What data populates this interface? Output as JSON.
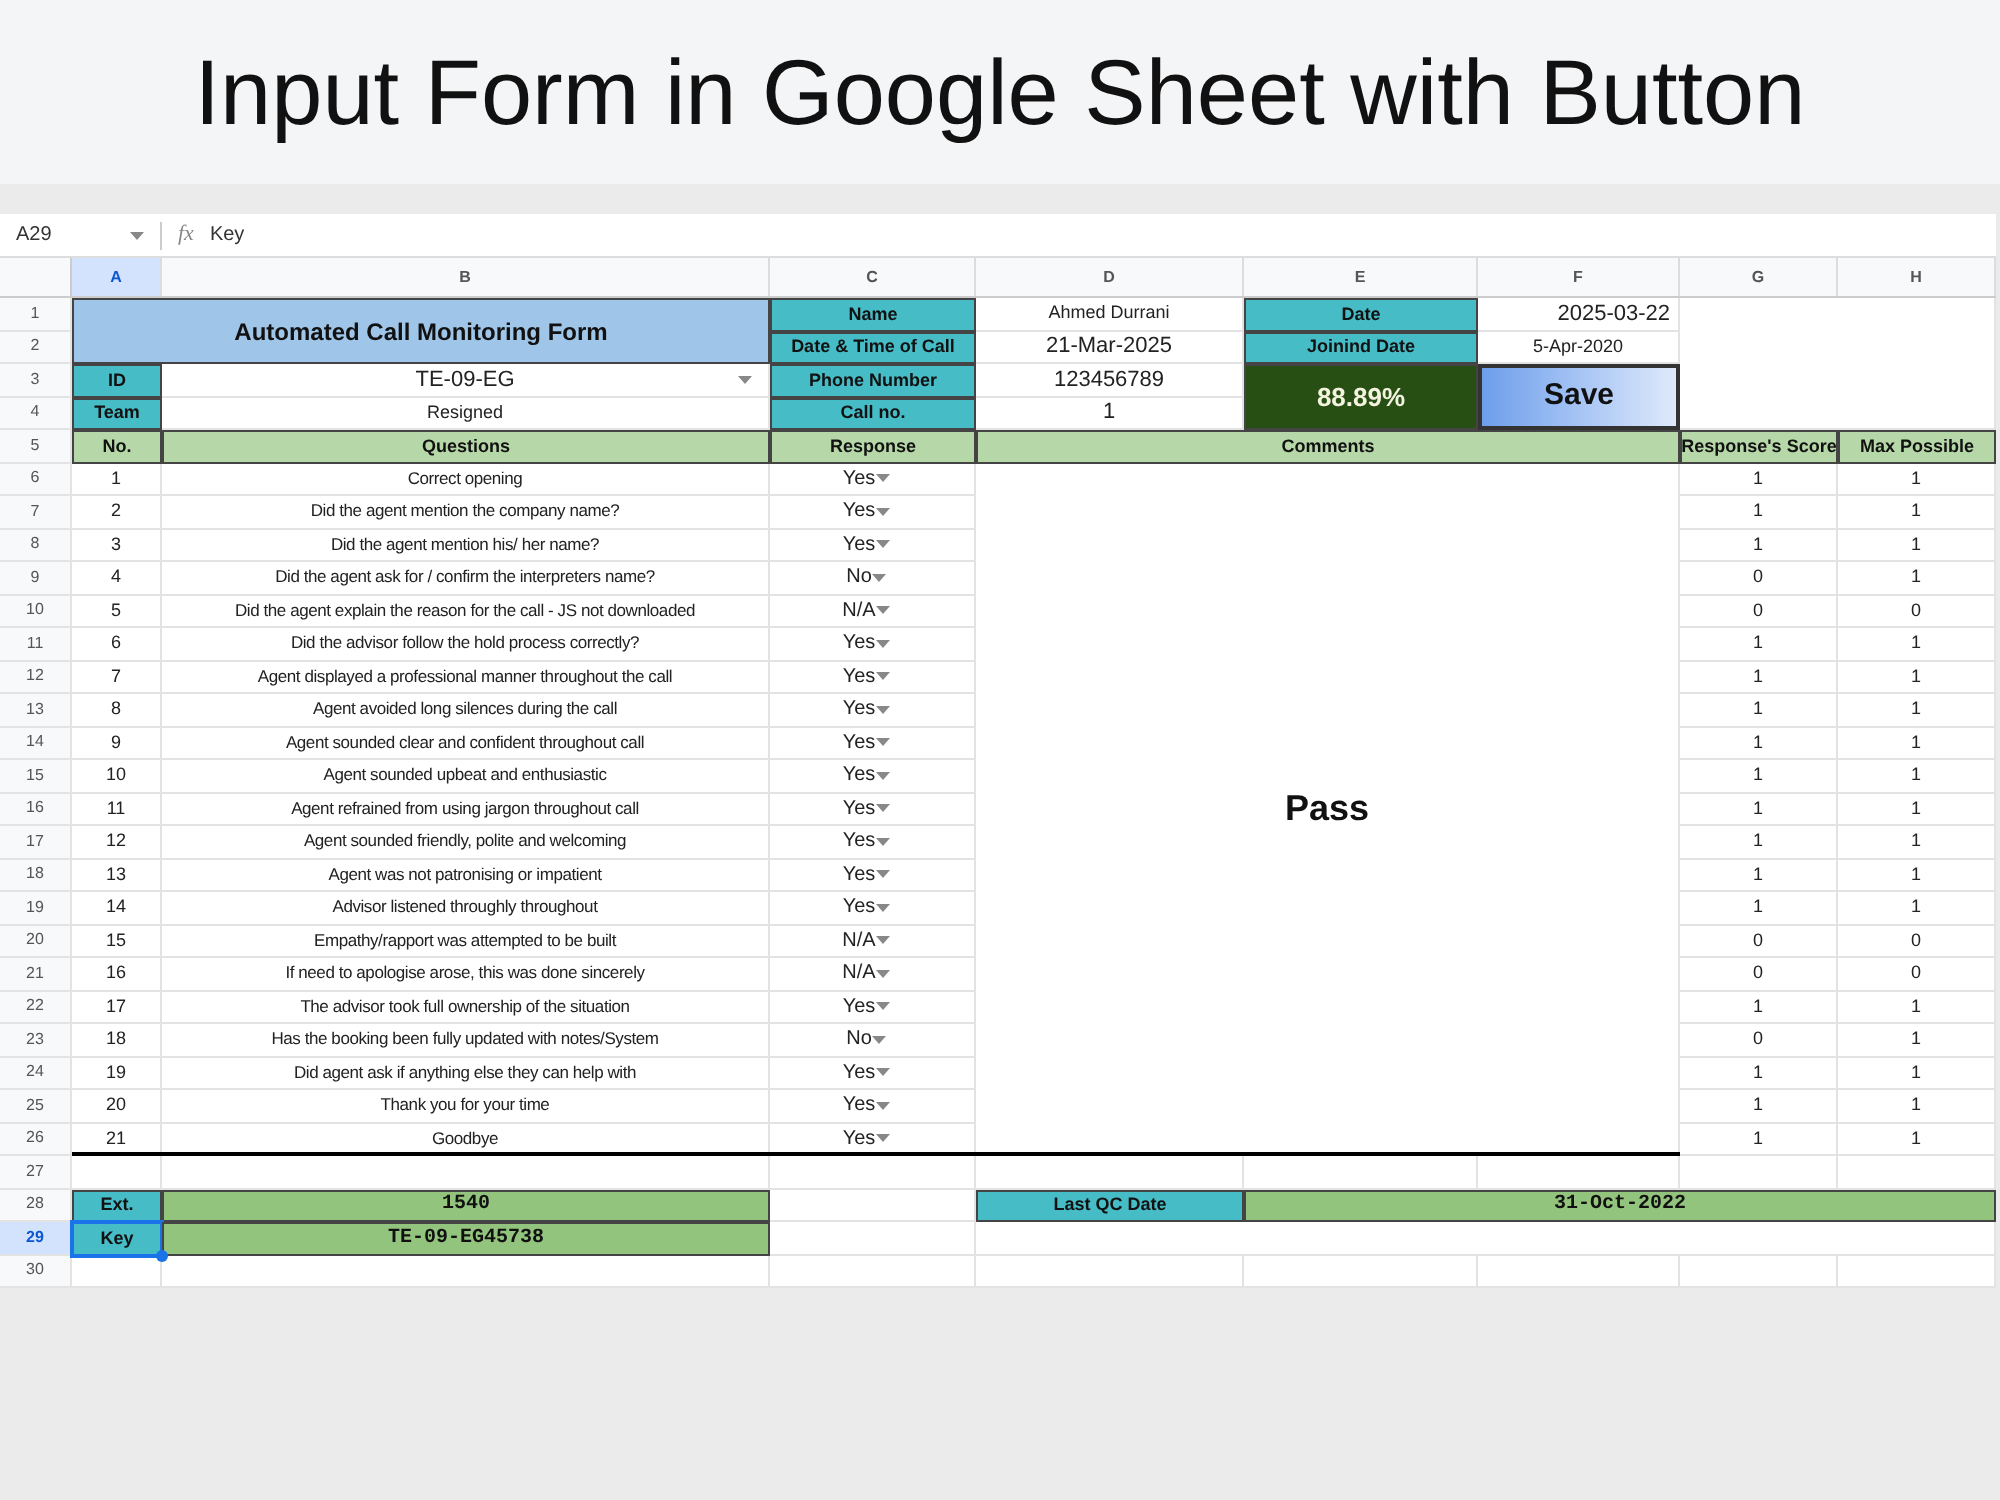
{
  "banner": {
    "title": "Input Form in Google Sheet with Button"
  },
  "formula_bar": {
    "cell_ref": "A29",
    "function_label": "fx",
    "formula": "Key"
  },
  "column_headers": [
    {
      "label": "A",
      "selected": true
    },
    {
      "label": "B",
      "selected": false
    },
    {
      "label": "C",
      "selected": false
    },
    {
      "label": "D",
      "selected": false
    },
    {
      "label": "E",
      "selected": false
    },
    {
      "label": "F",
      "selected": false
    },
    {
      "label": "G",
      "selected": false
    },
    {
      "label": "H",
      "selected": false
    }
  ],
  "row_numbers": [
    {
      "label": "1",
      "selected": false
    },
    {
      "label": "2",
      "selected": false
    },
    {
      "label": "3",
      "selected": false
    },
    {
      "label": "4",
      "selected": false
    },
    {
      "label": "5",
      "selected": false
    },
    {
      "label": "6",
      "selected": false
    },
    {
      "label": "7",
      "selected": false
    },
    {
      "label": "8",
      "selected": false
    },
    {
      "label": "9",
      "selected": false
    },
    {
      "label": "10",
      "selected": false
    },
    {
      "label": "11",
      "selected": false
    },
    {
      "label": "12",
      "selected": false
    },
    {
      "label": "13",
      "selected": false
    },
    {
      "label": "14",
      "selected": false
    },
    {
      "label": "15",
      "selected": false
    },
    {
      "label": "16",
      "selected": false
    },
    {
      "label": "17",
      "selected": false
    },
    {
      "label": "18",
      "selected": false
    },
    {
      "label": "19",
      "selected": false
    },
    {
      "label": "20",
      "selected": false
    },
    {
      "label": "21",
      "selected": false
    },
    {
      "label": "22",
      "selected": false
    },
    {
      "label": "23",
      "selected": false
    },
    {
      "label": "24",
      "selected": false
    },
    {
      "label": "25",
      "selected": false
    },
    {
      "label": "26",
      "selected": false
    },
    {
      "label": "27",
      "selected": false
    },
    {
      "label": "28",
      "selected": false
    },
    {
      "label": "29",
      "selected": true
    },
    {
      "label": "30",
      "selected": false
    }
  ],
  "form": {
    "title": "Automated Call Monitoring Form",
    "id_label": "ID",
    "id_value": "TE-09-EG",
    "team_label": "Team",
    "team_value": "Resigned",
    "info": [
      {
        "label": "Name",
        "value": "Ahmed Durrani"
      },
      {
        "label": "Date & Time of Call",
        "value": "21-Mar-2025"
      },
      {
        "label": "Phone Number",
        "value": "123456789"
      },
      {
        "label": "Call no.",
        "value": "1"
      }
    ],
    "date_label": "Date",
    "date_value": "2025-03-22",
    "joining_label": "Joinind Date",
    "joining_value": "5-Apr-2020",
    "score": "88.89%",
    "save_button": "Save"
  },
  "table": {
    "columns": [
      "No.",
      "Questions",
      "Response",
      "Comments",
      "Response's Score",
      "Max Possible"
    ],
    "comment": "Pass",
    "rows": [
      {
        "no": "1",
        "question": "Correct opening",
        "response": "Yes",
        "score": "1",
        "max": "1"
      },
      {
        "no": "2",
        "question": "Did the agent mention the company name?",
        "response": "Yes",
        "score": "1",
        "max": "1"
      },
      {
        "no": "3",
        "question": "Did the agent mention his/ her name?",
        "response": "Yes",
        "score": "1",
        "max": "1"
      },
      {
        "no": "4",
        "question": "Did the agent ask for / confirm the interpreters name?",
        "response": "No",
        "score": "0",
        "max": "1"
      },
      {
        "no": "5",
        "question": "Did the agent explain the reason for the call - JS not downloaded",
        "response": "N/A",
        "score": "0",
        "max": "0"
      },
      {
        "no": "6",
        "question": "Did the advisor follow the hold process correctly?",
        "response": "Yes",
        "score": "1",
        "max": "1"
      },
      {
        "no": "7",
        "question": "Agent displayed a professional manner throughout the call",
        "response": "Yes",
        "score": "1",
        "max": "1"
      },
      {
        "no": "8",
        "question": "Agent avoided long silences during the call",
        "response": "Yes",
        "score": "1",
        "max": "1"
      },
      {
        "no": "9",
        "question": "Agent sounded clear and confident throughout call",
        "response": "Yes",
        "score": "1",
        "max": "1"
      },
      {
        "no": "10",
        "question": "Agent sounded upbeat and enthusiastic",
        "response": "Yes",
        "score": "1",
        "max": "1"
      },
      {
        "no": "11",
        "question": "Agent refrained from using jargon throughout call",
        "response": "Yes",
        "score": "1",
        "max": "1"
      },
      {
        "no": "12",
        "question": "Agent sounded friendly, polite and welcoming",
        "response": "Yes",
        "score": "1",
        "max": "1"
      },
      {
        "no": "13",
        "question": "Agent was not patronising or impatient",
        "response": "Yes",
        "score": "1",
        "max": "1"
      },
      {
        "no": "14",
        "question": "Advisor listened throughly throughout",
        "response": "Yes",
        "score": "1",
        "max": "1"
      },
      {
        "no": "15",
        "question": "Empathy/rapport was attempted to be built",
        "response": "N/A",
        "score": "0",
        "max": "0"
      },
      {
        "no": "16",
        "question": "If need to apologise arose, this was done sincerely",
        "response": "N/A",
        "score": "0",
        "max": "0"
      },
      {
        "no": "17",
        "question": "The advisor took full ownership of the situation",
        "response": "Yes",
        "score": "1",
        "max": "1"
      },
      {
        "no": "18",
        "question": "Has the booking been fully updated with notes/System",
        "response": "No",
        "score": "0",
        "max": "1"
      },
      {
        "no": "19",
        "question": "Did agent ask if anything else they can help with",
        "response": "Yes",
        "score": "1",
        "max": "1"
      },
      {
        "no": "20",
        "question": "Thank you for your time",
        "response": "Yes",
        "score": "1",
        "max": "1"
      },
      {
        "no": "21",
        "question": "Goodbye",
        "response": "Yes",
        "score": "1",
        "max": "1"
      }
    ]
  },
  "footer": {
    "ext_label": "Ext.",
    "ext_value": "1540",
    "key_label": "Key",
    "key_value": "TE-09-EG45738",
    "last_qc_label": "Last QC Date",
    "last_qc_value": "31-Oct-2022"
  }
}
